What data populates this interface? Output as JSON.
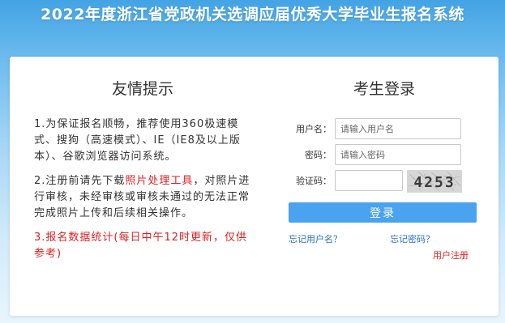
{
  "header": {
    "title": "2022年度浙江省党政机关选调应届优秀大学毕业生报名系统"
  },
  "notice": {
    "title": "友情提示",
    "item1": "1.为保证报名顺畅，推荐使用360极速模式、搜狗（高速模式）、IE（IE8及以上版本）、谷歌浏览器访问系统。",
    "item2_before": "2.注册前请先下载",
    "item2_link": "照片处理工具",
    "item2_after": "，对照片进行审核，未经审核或审核未通过的无法正常完成照片上传和后续相关操作。",
    "item3": "3.报名数据统计(每日中午12时更新，仅供参考)"
  },
  "login": {
    "title": "考生登录",
    "username_label": "用户名：",
    "username_placeholder": "请输入用户名",
    "password_label": "密码：",
    "password_placeholder": "请输入密码",
    "captcha_label": "验证码：",
    "captcha_value": "",
    "captcha_text": "4253",
    "submit_label": "登录",
    "forgot_username": "忘记用户名？",
    "forgot_password": "忘记密码？",
    "register": "用户注册"
  },
  "colors": {
    "accent": "#4aa3ee",
    "link": "#2a6fc4",
    "warning": "#e02020"
  }
}
